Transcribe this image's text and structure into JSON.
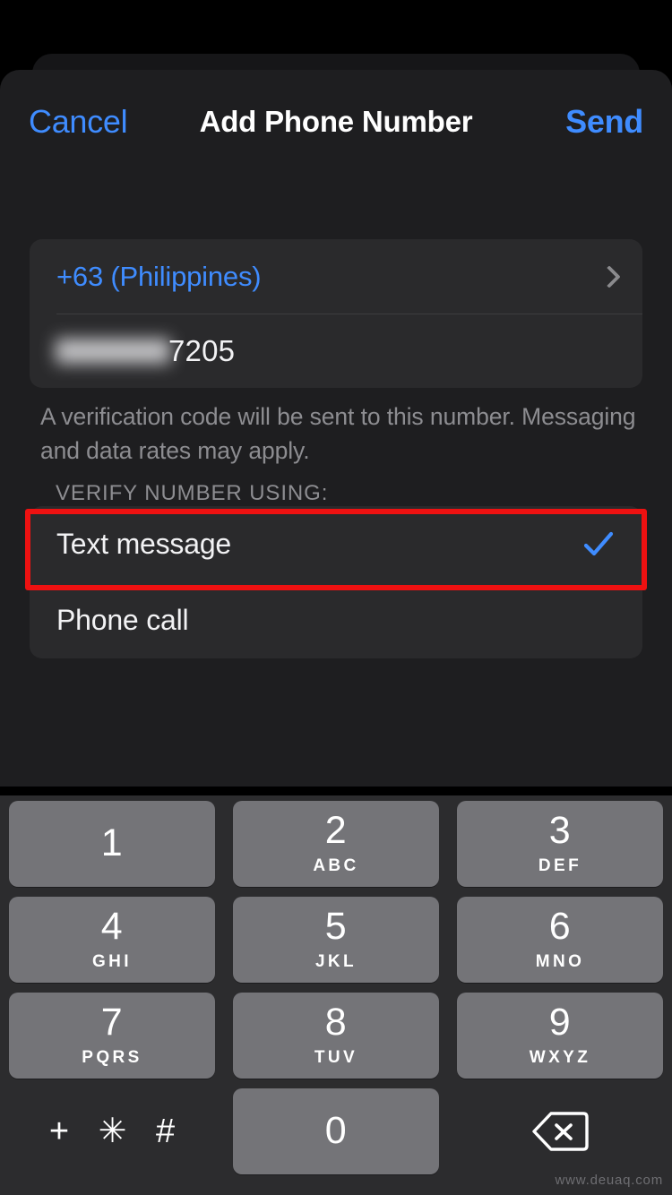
{
  "navbar": {
    "cancel_label": "Cancel",
    "title": "Add Phone Number",
    "send_label": "Send"
  },
  "form": {
    "country_label": "+63 (Philippines)",
    "country_chevron_icon": "chevron-right-icon",
    "phone_number_visible": "7205",
    "phone_number_redacted": true
  },
  "helper_text": "A verification code will be sent to this number. Messaging and data rates may apply.",
  "section": {
    "header": "VERIFY NUMBER USING:",
    "options": [
      {
        "label": "Text message",
        "selected": true,
        "check_icon": "checkmark-icon"
      },
      {
        "label": "Phone call",
        "selected": false,
        "check_icon": ""
      }
    ]
  },
  "annotation": {
    "highlight_color": "#ee1111",
    "target": "Text message"
  },
  "colors": {
    "accent_blue": "#3f8cff",
    "sheet_bg": "#1e1e20",
    "card_bg": "#2a2a2c",
    "keypad_bg": "#2c2c2e",
    "key_bg": "#747478",
    "secondary_text": "#8d8d91"
  },
  "keypad": {
    "rows": [
      [
        {
          "digit": "1",
          "letters": ""
        },
        {
          "digit": "2",
          "letters": "ABC"
        },
        {
          "digit": "3",
          "letters": "DEF"
        }
      ],
      [
        {
          "digit": "4",
          "letters": "GHI"
        },
        {
          "digit": "5",
          "letters": "JKL"
        },
        {
          "digit": "6",
          "letters": "MNO"
        }
      ],
      [
        {
          "digit": "7",
          "letters": "PQRS"
        },
        {
          "digit": "8",
          "letters": "TUV"
        },
        {
          "digit": "9",
          "letters": "WXYZ"
        }
      ]
    ],
    "symbols_key": "+ ✳ #",
    "zero_key": "0",
    "delete_icon": "backspace-delete-icon"
  },
  "watermark": "www.deuaq.com"
}
